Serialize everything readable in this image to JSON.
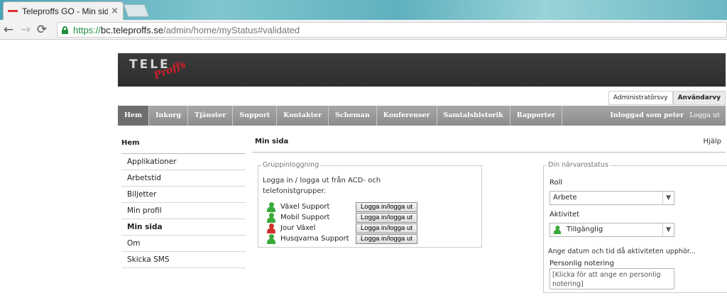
{
  "browser": {
    "tab_title": "Teleproffs GO - Min sida",
    "tab_close": "×",
    "url_scheme": "https://",
    "url_host": "bc.teleproffs.se",
    "url_path": "/admin/home/myStatus#validated",
    "back": "←",
    "forward": "→",
    "reload": "⟳"
  },
  "logo": {
    "part1": "TELE",
    "part2": "Proffs"
  },
  "viewtabs": [
    "Administratörsvy",
    "Användarvy"
  ],
  "nav": {
    "items": [
      "Hem",
      "Inkorg",
      "Tjänster",
      "Support",
      "Kontakter",
      "Scheman",
      "Konferenser",
      "Samtalshistorik",
      "Rapporter"
    ],
    "logged_in": "Inloggad som peter",
    "logout": "Logga ut"
  },
  "sidebar": {
    "title": "Hem",
    "items": [
      "Applikationer",
      "Arbetstid",
      "Biljetter",
      "Min profil",
      "Min sida",
      "Om",
      "Skicka SMS"
    ]
  },
  "content": {
    "title": "Min sida",
    "help": "Hjälp"
  },
  "group_login": {
    "legend": "Gruppinloggning",
    "description": "Logga in / logga ut från ACD- och telefonistgrupper.",
    "button_label": "Logga in/logga ut",
    "groups": [
      {
        "name": "Växel Support",
        "status": "green"
      },
      {
        "name": "Mobil Support",
        "status": "green"
      },
      {
        "name": "Jour Växel",
        "status": "red"
      },
      {
        "name": "Husqvarna Support",
        "status": "green"
      }
    ]
  },
  "presence": {
    "legend": "Din närvarostatus",
    "role_label": "Roll",
    "role_value": "Arbete",
    "activity_label": "Aktivitet",
    "activity_value": "Tillgänglig",
    "datetime_link": "Ange datum och tid då aktiviteten upphör...",
    "note_label": "Personlig notering",
    "note_placeholder": "[Klicka för att ange en personlig notering]",
    "dropdown_arrow": "▼"
  }
}
